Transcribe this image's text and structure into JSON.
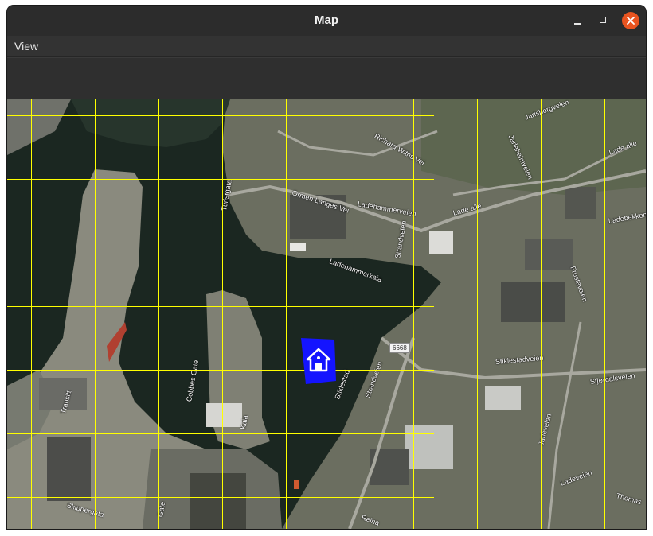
{
  "window": {
    "title": "Map"
  },
  "menu": {
    "view_label": "View"
  },
  "icons": {
    "minimize": "minimize-icon",
    "maximize": "maximize-icon",
    "close": "close-icon",
    "marker": "home-icon"
  },
  "colors": {
    "grid": "#ffff00",
    "marker": "#1010ff",
    "close": "#e95420"
  },
  "map": {
    "labels": {
      "jarlsborgveien": "Jarlsborgveien",
      "richard_withs": "Richard Withs Vei",
      "jarlehaugen": "Jarleheimveien",
      "lade_alle_1": "Lade alle",
      "lade_alle_2": "Lade alle",
      "ladebekk": "Ladebekken",
      "ormen_langes": "Ormen Langes Vei",
      "ladehammer": "Ladehammerveien",
      "ladehammerkaia": "Ladehammerkaia",
      "strandveien": "Strandveien",
      "stiklestadveien": "Stiklestadveien",
      "stjordalsveien": "Stjørdalsveien",
      "frostaveien": "Frostaveien",
      "jarleveien": "Jarleveien",
      "ladeveien": "Ladeveien",
      "thomas": "Thomas",
      "turistgata": "Turistgata",
      "cobbes_gate": "Cobbes Gate",
      "skippergata": "Skippergata",
      "reina": "Reina",
      "haroldsgate": "Gate",
      "strandveien2": "Strandveien",
      "stiklestad2": "Stiklestad",
      "ovre": "Transitt",
      "grans": "Kaia",
      "shield": "6668"
    }
  }
}
